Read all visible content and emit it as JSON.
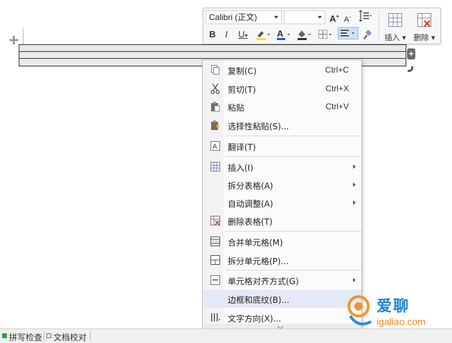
{
  "toolbar": {
    "font_name": "Calibri (正文)",
    "font_size": "",
    "insert_label": "插入",
    "delete_label": "删除",
    "bold": "B",
    "italic": "I",
    "underline": "U",
    "font_color_letter": "A",
    "grow_font": "A",
    "shrink_font": "A",
    "icons": [
      "grow-font-icon",
      "shrink-font-icon",
      "line-spacing-icon",
      "insert-table-icon",
      "delete-table-icon",
      "highlight-icon",
      "font-color-icon",
      "shading-icon",
      "borders-icon",
      "align-icon",
      "format-painter-icon"
    ],
    "colors": {
      "font_color": "#2b4fd8",
      "highlight": "#f5e03c",
      "shading": "#333333"
    }
  },
  "context_menu": {
    "items": [
      {
        "label": "复制(C)",
        "shortcut": "Ctrl+C",
        "icon": "copy-icon"
      },
      {
        "label": "剪切(T)",
        "shortcut": "Ctrl+X",
        "icon": "cut-icon"
      },
      {
        "label": "粘贴",
        "shortcut": "Ctrl+V",
        "icon": "paste-icon"
      },
      {
        "label": "选择性粘贴(S)...",
        "shortcut": "",
        "icon": "paste-special-icon"
      },
      {
        "label": "翻译(T)",
        "shortcut": "",
        "icon": "translate-icon"
      },
      {
        "label": "插入(I)",
        "shortcut": "",
        "icon": "insert-table-icon",
        "submenu": true
      },
      {
        "label": "拆分表格(A)",
        "shortcut": "",
        "icon": "",
        "submenu": true
      },
      {
        "label": "自动调整(A)",
        "shortcut": "",
        "icon": "",
        "submenu": true
      },
      {
        "label": "删除表格(T)",
        "shortcut": "",
        "icon": "delete-table-icon"
      },
      {
        "label": "合并单元格(M)",
        "shortcut": "",
        "icon": "merge-cells-icon"
      },
      {
        "label": "拆分单元格(P)...",
        "shortcut": "",
        "icon": "split-cells-icon"
      },
      {
        "label": "单元格对齐方式(G)",
        "shortcut": "",
        "icon": "cell-align-icon",
        "submenu": true
      },
      {
        "label": "边框和底纹(B)...",
        "shortcut": "",
        "icon": "",
        "highlighted": true
      },
      {
        "label": "文字方向(X)...",
        "shortcut": "",
        "icon": "text-direction-icon"
      }
    ]
  },
  "status_bar": {
    "spell_check": "拼写检查",
    "doc_proof": "文档校对"
  },
  "watermark": {
    "text1": "爱聊",
    "text2": "igaliao.com"
  }
}
